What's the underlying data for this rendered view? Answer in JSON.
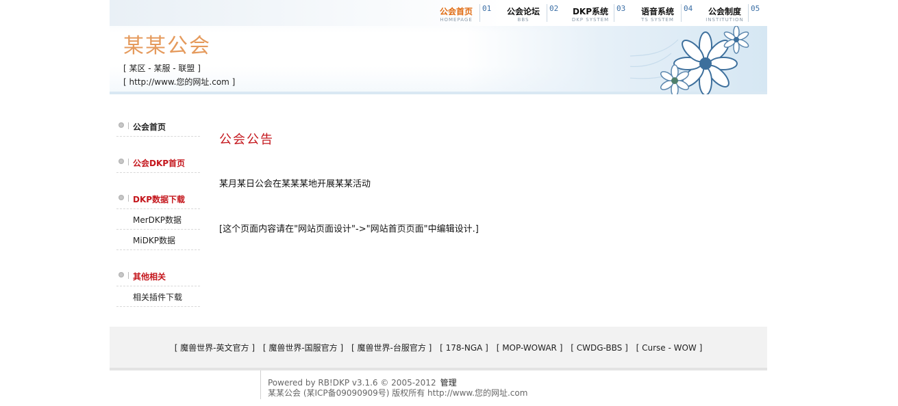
{
  "nav": [
    {
      "cn": "公会首页",
      "en": "HOMEPAGE",
      "num": "01",
      "active": true
    },
    {
      "cn": "公会论坛",
      "en": "BBS",
      "num": "02"
    },
    {
      "cn": "DKP系统",
      "en": "DKP SYSTEM",
      "num": "03"
    },
    {
      "cn": "语音系统",
      "en": "TS SYSTEM",
      "num": "04"
    },
    {
      "cn": "公会制度",
      "en": "INSTITUTION",
      "num": "05"
    }
  ],
  "header": {
    "title": "某某公会",
    "subtitle": "[ 某区 - 某服 - 联盟 ]",
    "url": "[ http://www.您的网址.com ]"
  },
  "sidebar": {
    "home": "公会首页",
    "dkp_home": "公会DKP首页",
    "dkp_download": "DKP数据下载",
    "merdkp": "MerDKP数据",
    "midkp": "MiDKP数据",
    "other": "其他相关",
    "plugins": "相关插件下载"
  },
  "content": {
    "title": "公会公告",
    "p1": "某月某日公会在某某某地开展某某活动",
    "p2": "[这个页面内容请在\"网站页面设计\"->\"网站首页页面\"中编辑设计.]"
  },
  "links": [
    "[ 魔兽世界-英文官方 ]",
    "[ 魔兽世界-国服官方 ]",
    "[ 魔兽世界-台服官方 ]",
    "[ 178-NGA ]",
    "[ MOP-WOWAR ]",
    "[ CWDG-BBS ]",
    "[ Curse - WOW ]"
  ],
  "footer": {
    "powered": "Powered by RB!DKP v3.1.6 © 2005-2012",
    "admin": "管理",
    "copyright": "某某公会 (某ICP备09090909号) 版权所有 http://www.您的网址.com"
  }
}
